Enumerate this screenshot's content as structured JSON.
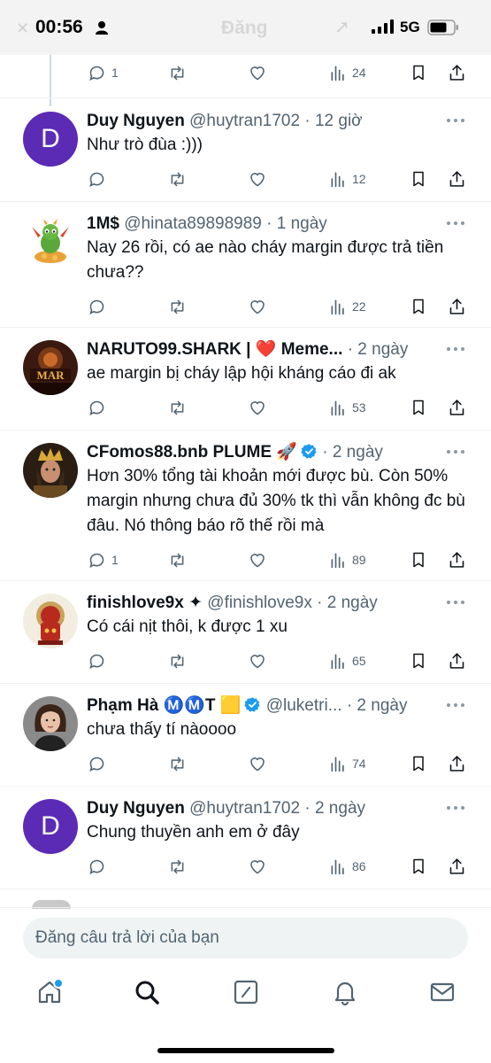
{
  "status": {
    "time": "00:56",
    "network": "5G",
    "faded_title": "Đăng"
  },
  "top_actions": {
    "reply_count": "1",
    "views": "24"
  },
  "tweets": [
    {
      "name": "Duy Nguyen",
      "handle": "@huytran1702",
      "time": "· 12 giờ",
      "text": "Như trò đùa :)))",
      "reply_count": "",
      "views": "12",
      "avatar_letter": "D",
      "avatar_color": "#5b2bb5"
    },
    {
      "name": "1M$",
      "handle": "@hinata89898989",
      "time": "· 1 ngày",
      "text": "Nay 26 rồi, có ae nào cháy margin được trả tiền chưa??",
      "reply_count": "",
      "views": "22",
      "avatar_icon": "dragon-avatar"
    },
    {
      "name": "NARUTO99.SHARK | ❤️ Meme...",
      "handle": "",
      "time": "· 2 ngày",
      "text": "ae margin bị cháy lập hội kháng cáo đi ak",
      "reply_count": "",
      "views": "53",
      "avatar_icon": "mar-avatar"
    },
    {
      "name": "CFomos88.bnb PLUME 🚀",
      "handle": "",
      "time": "· 2 ngày",
      "text": "Hơn 30% tổng tài khoản mới được bù. Còn 50% margin nhưng chưa đủ 30% tk thì vẫn không đc bù đâu. Nó thông báo rõ thế rồi mà",
      "reply_count": "1",
      "views": "89",
      "avatar_icon": "king-avatar",
      "verified": true
    },
    {
      "name": "finishlove9x ✦",
      "handle": "@finishlove9x",
      "time": "· 2 ngày",
      "text": "Có cái nịt thôi, k được 1 xu",
      "reply_count": "",
      "views": "65",
      "avatar_icon": "robot-avatar"
    },
    {
      "name": "Phạm Hà Ⓜ️Ⓜ️T 🟨",
      "handle": "@luketri...",
      "time": "· 2 ngày",
      "text": "chưa thấy tí nàoooo",
      "reply_count": "",
      "views": "74",
      "avatar_icon": "woman-avatar",
      "verified": true
    },
    {
      "name": "Duy Nguyen",
      "handle": "@huytran1702",
      "time": "· 2 ngày",
      "text": "Chung thuyền anh em ở đây",
      "reply_count": "",
      "views": "86",
      "avatar_letter": "D",
      "avatar_color": "#5b2bb5"
    }
  ],
  "reply_input": {
    "placeholder": "Đăng câu trả lời của bạn"
  },
  "tabs": [
    "home-icon",
    "search-icon",
    "compose-icon",
    "bell-icon",
    "mail-icon"
  ],
  "colors": {
    "accent": "#1d9bf0",
    "muted": "#536471",
    "verified": "#1d9bf0"
  }
}
